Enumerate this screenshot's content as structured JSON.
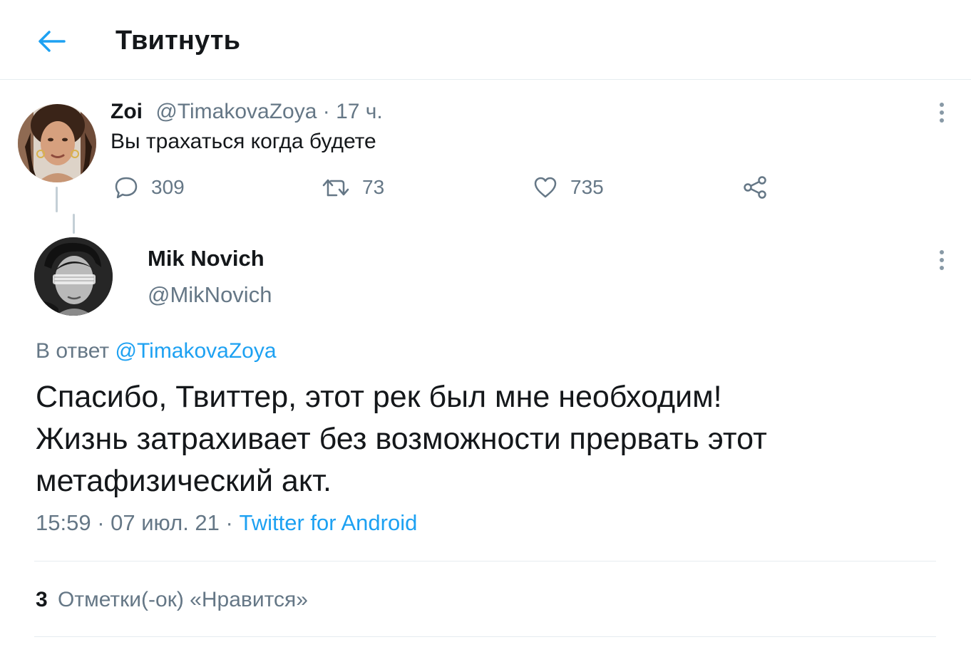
{
  "header": {
    "title": "Твитнуть",
    "back_icon": "arrow-left-icon"
  },
  "colors": {
    "accent": "#1da1f2",
    "muted": "#657786",
    "text": "#14171a",
    "divider": "#e6ecf0"
  },
  "parent_tweet": {
    "display_name": "Zoi",
    "handle": "@TimakovaZoya",
    "separator": " · ",
    "time_ago": "17 ч.",
    "text": "Вы трахаться когда будете",
    "replies": "309",
    "retweets": "73",
    "likes": "735"
  },
  "main_tweet": {
    "display_name": "Mik Novich",
    "handle": "@MikNovich",
    "reply_prefix": "В ответ ",
    "reply_handle": "@TimakovaZoya",
    "text_lines": [
      "Спасибо, Твиттер, этот рек был мне необходим!",
      "Жизнь затрахивает без возможности прервать этот",
      "метафизический акт."
    ],
    "time": "15:59",
    "date": "07 июл. 21",
    "source": "Twitter for Android",
    "like_count": "3",
    "like_label": "Отметки(-ок) «Нравится»"
  }
}
